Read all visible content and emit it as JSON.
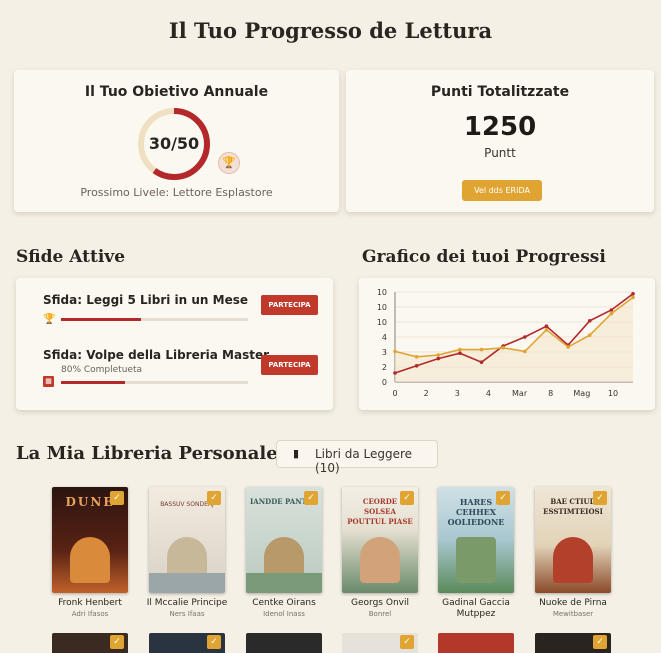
{
  "page": {
    "title": "Il Tuo Progresso de Lettura"
  },
  "goal": {
    "title": "Il Tuo Obietivo Annuale",
    "progress_text": "30/50",
    "progress_fraction": 0.6,
    "next_level": "Prossimo Livele: Lettore Esplastore",
    "trophy_icon": "trophy-icon"
  },
  "points": {
    "title": "Punti Totalitzzate",
    "value": "1250",
    "unit": "Puntt",
    "button": "Vel dds  ERIDA"
  },
  "challenges": {
    "heading": "Sfide Attive",
    "items": [
      {
        "title": "Sfida: Leggi 5 Libri in un Mese",
        "subtitle": "",
        "progress": 0.43,
        "button": "PARTECIPA",
        "icon": "trophy-icon"
      },
      {
        "title": "Sfida: Volpe della Libreria Master",
        "subtitle": "80% Completueta",
        "progress": 0.34,
        "button": "PARTECIPA",
        "icon": "calendar-icon"
      }
    ]
  },
  "chart": {
    "heading": "Grafico dei tuoi Progressi",
    "y_ticks": [
      "10",
      "10",
      "10",
      "4",
      "3",
      "2",
      "0"
    ],
    "x_ticks": [
      "0",
      "2",
      "3",
      "4",
      "Mar",
      "8",
      "Mag",
      "10"
    ]
  },
  "chart_data": {
    "type": "line",
    "title": "Grafico dei tuoi Progressi",
    "x": [
      "0",
      "1",
      "2",
      "3",
      "4",
      "Mar",
      "6",
      "8",
      "9",
      "Mag",
      "10",
      "11"
    ],
    "series": [
      {
        "values": [
          1,
          1.8,
          2.6,
          3.2,
          2.2,
          4.0,
          5.0,
          6.2,
          4.1,
          6.8,
          8.0,
          9.8
        ]
      },
      {
        "values": [
          3.4,
          2.8,
          3.0,
          3.6,
          3.6,
          3.8,
          3.4,
          5.8,
          3.9,
          5.2,
          7.6,
          9.4
        ]
      }
    ],
    "ylim": [
      0,
      10
    ],
    "grid": true,
    "colors": [
      "#b3282a",
      "#e0a432"
    ]
  },
  "library": {
    "heading": "La Mia Libreria Personale",
    "filter_label": "Libri da Leggere (10)",
    "filter_icon": "book-icon",
    "books": [
      {
        "cover_title": "DUNE",
        "cover_sub": "",
        "author": "Fronk Henbert",
        "subtitle": "Adri Ifasos"
      },
      {
        "cover_title": "",
        "cover_sub": "BASSUV SONDERJ",
        "author": "Il Mccalie Principe",
        "subtitle": "Ners Ifaas"
      },
      {
        "cover_title": "IANDDE PANTRE",
        "cover_sub": "",
        "author": "Centke Oirans",
        "subtitle": "Idenol Inass"
      },
      {
        "cover_title": "CEORDE SOLSEA POUTTUL PIASE",
        "cover_sub": "",
        "author": "Georgs Onvil",
        "subtitle": "Bonrel"
      },
      {
        "cover_title": "HARES CEHHEX OOLIEDONE",
        "cover_sub": "",
        "author": "Gadinal Gaccia Mutppez",
        "subtitle": ""
      },
      {
        "cover_title": "BAE CTIUD ESSTIMTEIOSI",
        "cover_sub": "",
        "author": "Nuoke de Pirna",
        "subtitle": "Mewitbaser"
      }
    ]
  },
  "colors": {
    "accent_red": "#b3282a",
    "accent_gold": "#e0a432",
    "background": "#f5f0e6"
  }
}
